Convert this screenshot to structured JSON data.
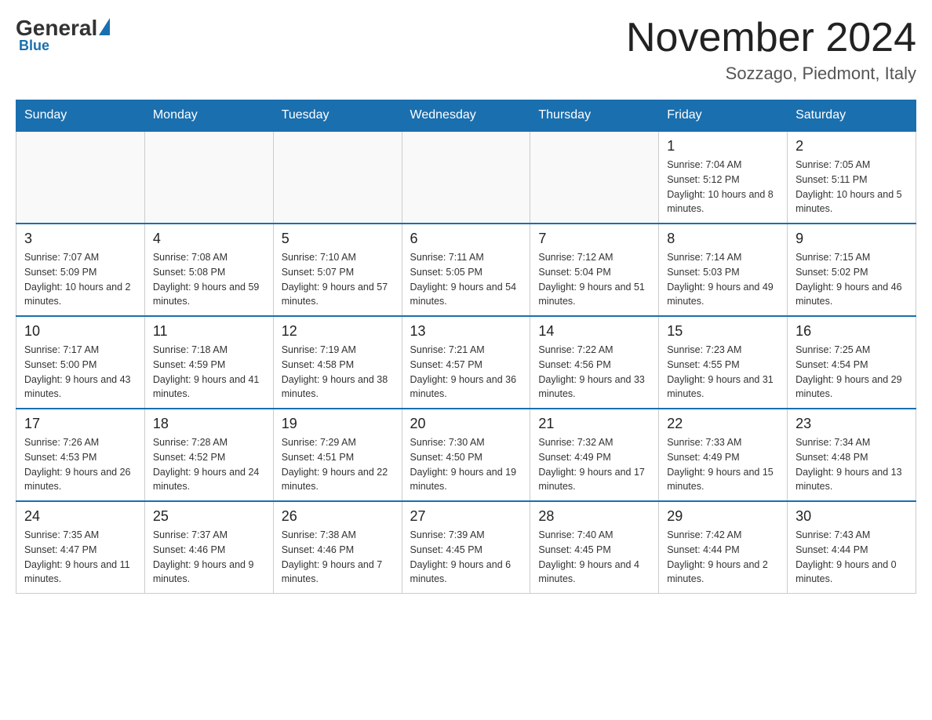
{
  "header": {
    "logo_text": "General",
    "logo_blue": "Blue",
    "month": "November 2024",
    "location": "Sozzago, Piedmont, Italy"
  },
  "weekdays": [
    "Sunday",
    "Monday",
    "Tuesday",
    "Wednesday",
    "Thursday",
    "Friday",
    "Saturday"
  ],
  "weeks": [
    [
      {
        "day": "",
        "info": ""
      },
      {
        "day": "",
        "info": ""
      },
      {
        "day": "",
        "info": ""
      },
      {
        "day": "",
        "info": ""
      },
      {
        "day": "",
        "info": ""
      },
      {
        "day": "1",
        "info": "Sunrise: 7:04 AM\nSunset: 5:12 PM\nDaylight: 10 hours and 8 minutes."
      },
      {
        "day": "2",
        "info": "Sunrise: 7:05 AM\nSunset: 5:11 PM\nDaylight: 10 hours and 5 minutes."
      }
    ],
    [
      {
        "day": "3",
        "info": "Sunrise: 7:07 AM\nSunset: 5:09 PM\nDaylight: 10 hours and 2 minutes."
      },
      {
        "day": "4",
        "info": "Sunrise: 7:08 AM\nSunset: 5:08 PM\nDaylight: 9 hours and 59 minutes."
      },
      {
        "day": "5",
        "info": "Sunrise: 7:10 AM\nSunset: 5:07 PM\nDaylight: 9 hours and 57 minutes."
      },
      {
        "day": "6",
        "info": "Sunrise: 7:11 AM\nSunset: 5:05 PM\nDaylight: 9 hours and 54 minutes."
      },
      {
        "day": "7",
        "info": "Sunrise: 7:12 AM\nSunset: 5:04 PM\nDaylight: 9 hours and 51 minutes."
      },
      {
        "day": "8",
        "info": "Sunrise: 7:14 AM\nSunset: 5:03 PM\nDaylight: 9 hours and 49 minutes."
      },
      {
        "day": "9",
        "info": "Sunrise: 7:15 AM\nSunset: 5:02 PM\nDaylight: 9 hours and 46 minutes."
      }
    ],
    [
      {
        "day": "10",
        "info": "Sunrise: 7:17 AM\nSunset: 5:00 PM\nDaylight: 9 hours and 43 minutes."
      },
      {
        "day": "11",
        "info": "Sunrise: 7:18 AM\nSunset: 4:59 PM\nDaylight: 9 hours and 41 minutes."
      },
      {
        "day": "12",
        "info": "Sunrise: 7:19 AM\nSunset: 4:58 PM\nDaylight: 9 hours and 38 minutes."
      },
      {
        "day": "13",
        "info": "Sunrise: 7:21 AM\nSunset: 4:57 PM\nDaylight: 9 hours and 36 minutes."
      },
      {
        "day": "14",
        "info": "Sunrise: 7:22 AM\nSunset: 4:56 PM\nDaylight: 9 hours and 33 minutes."
      },
      {
        "day": "15",
        "info": "Sunrise: 7:23 AM\nSunset: 4:55 PM\nDaylight: 9 hours and 31 minutes."
      },
      {
        "day": "16",
        "info": "Sunrise: 7:25 AM\nSunset: 4:54 PM\nDaylight: 9 hours and 29 minutes."
      }
    ],
    [
      {
        "day": "17",
        "info": "Sunrise: 7:26 AM\nSunset: 4:53 PM\nDaylight: 9 hours and 26 minutes."
      },
      {
        "day": "18",
        "info": "Sunrise: 7:28 AM\nSunset: 4:52 PM\nDaylight: 9 hours and 24 minutes."
      },
      {
        "day": "19",
        "info": "Sunrise: 7:29 AM\nSunset: 4:51 PM\nDaylight: 9 hours and 22 minutes."
      },
      {
        "day": "20",
        "info": "Sunrise: 7:30 AM\nSunset: 4:50 PM\nDaylight: 9 hours and 19 minutes."
      },
      {
        "day": "21",
        "info": "Sunrise: 7:32 AM\nSunset: 4:49 PM\nDaylight: 9 hours and 17 minutes."
      },
      {
        "day": "22",
        "info": "Sunrise: 7:33 AM\nSunset: 4:49 PM\nDaylight: 9 hours and 15 minutes."
      },
      {
        "day": "23",
        "info": "Sunrise: 7:34 AM\nSunset: 4:48 PM\nDaylight: 9 hours and 13 minutes."
      }
    ],
    [
      {
        "day": "24",
        "info": "Sunrise: 7:35 AM\nSunset: 4:47 PM\nDaylight: 9 hours and 11 minutes."
      },
      {
        "day": "25",
        "info": "Sunrise: 7:37 AM\nSunset: 4:46 PM\nDaylight: 9 hours and 9 minutes."
      },
      {
        "day": "26",
        "info": "Sunrise: 7:38 AM\nSunset: 4:46 PM\nDaylight: 9 hours and 7 minutes."
      },
      {
        "day": "27",
        "info": "Sunrise: 7:39 AM\nSunset: 4:45 PM\nDaylight: 9 hours and 6 minutes."
      },
      {
        "day": "28",
        "info": "Sunrise: 7:40 AM\nSunset: 4:45 PM\nDaylight: 9 hours and 4 minutes."
      },
      {
        "day": "29",
        "info": "Sunrise: 7:42 AM\nSunset: 4:44 PM\nDaylight: 9 hours and 2 minutes."
      },
      {
        "day": "30",
        "info": "Sunrise: 7:43 AM\nSunset: 4:44 PM\nDaylight: 9 hours and 0 minutes."
      }
    ]
  ]
}
